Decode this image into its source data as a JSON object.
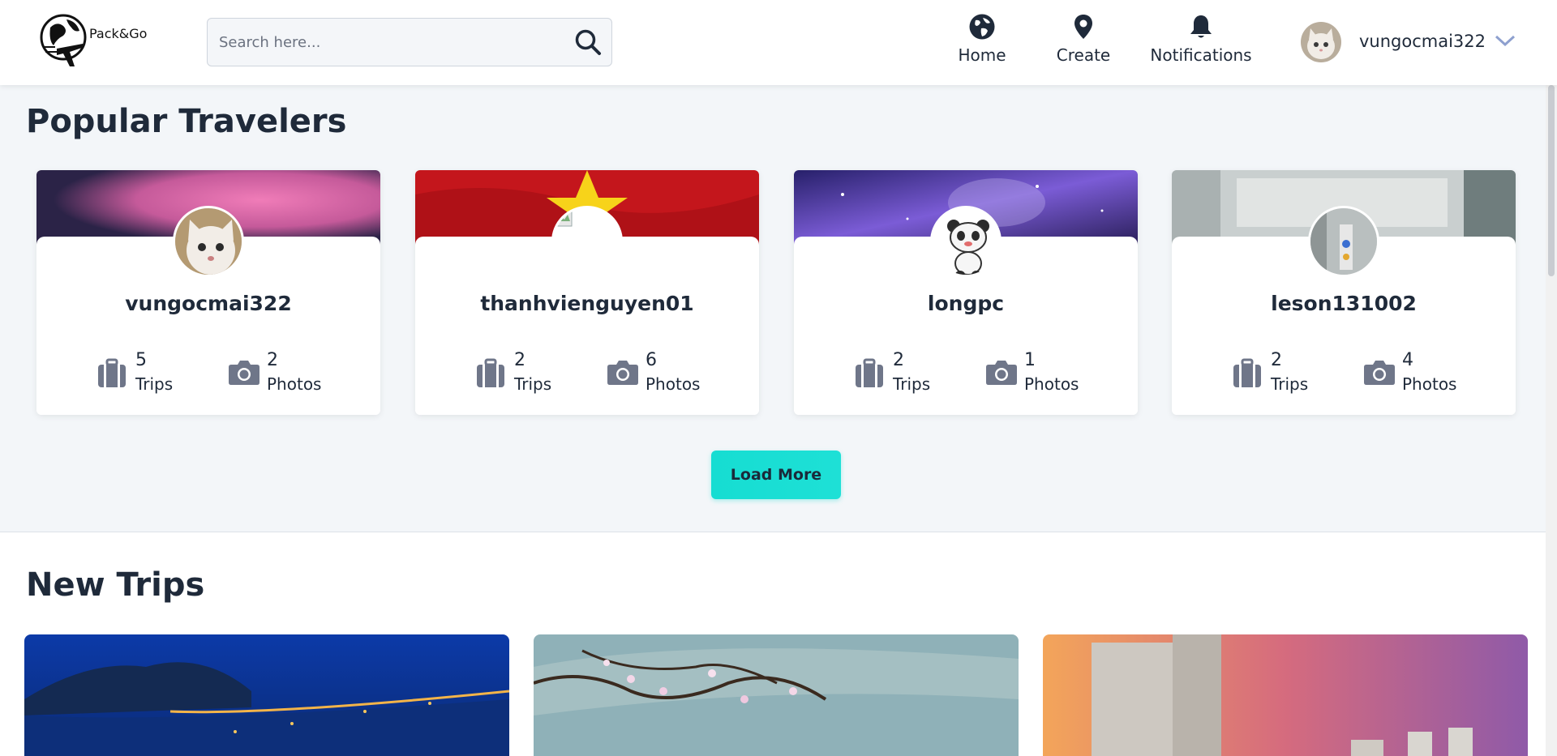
{
  "header": {
    "logo_text": "Pack&Go",
    "search_placeholder": "Search here...",
    "nav": {
      "home": "Home",
      "create": "Create",
      "notifications": "Notifications"
    },
    "username": "vungocmai322"
  },
  "popular": {
    "title": "Popular Travelers",
    "travelers": [
      {
        "name": "vungocmai322",
        "trips": "5",
        "trips_label": "Trips",
        "photos": "2",
        "photos_label": "Photos"
      },
      {
        "name": "thanhvienguyen01",
        "trips": "2",
        "trips_label": "Trips",
        "photos": "6",
        "photos_label": "Photos"
      },
      {
        "name": "longpc",
        "trips": "2",
        "trips_label": "Trips",
        "photos": "1",
        "photos_label": "Photos"
      },
      {
        "name": "leson131002",
        "trips": "2",
        "trips_label": "Trips",
        "photos": "4",
        "photos_label": "Photos"
      }
    ],
    "load_more": "Load More"
  },
  "new_trips": {
    "title": "New Trips"
  },
  "colors": {
    "accent": "#16ddd2",
    "text": "#1f2a3a",
    "icon_gray": "#6b7280"
  }
}
